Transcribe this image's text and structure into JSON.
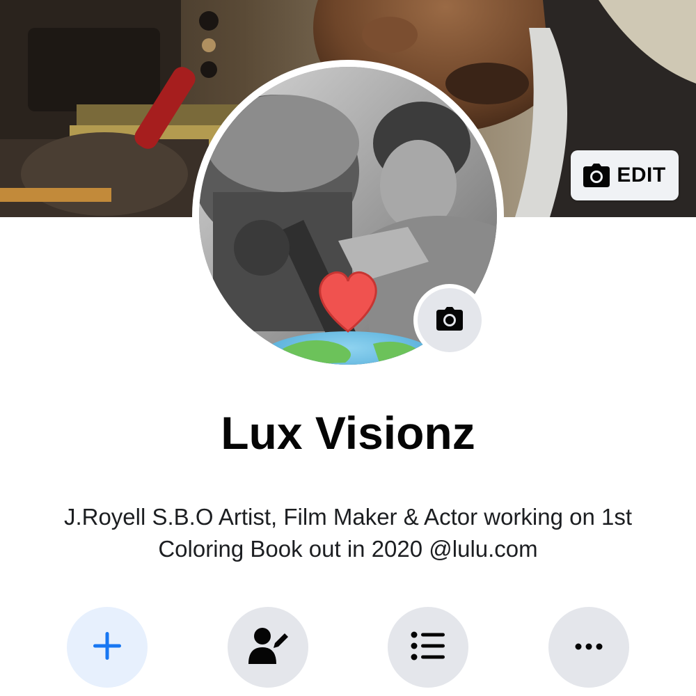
{
  "cover": {
    "edit_label": "EDIT",
    "edit_icon": "camera-icon"
  },
  "profile": {
    "name": "Lux Visionz",
    "bio": "J.Royell S.B.O Artist, Film Maker & Actor working on 1st Coloring Book out in 2020 @lulu.com",
    "camera_icon": "camera-icon"
  },
  "actions": [
    {
      "icon": "plus-icon"
    },
    {
      "icon": "edit-profile-icon"
    },
    {
      "icon": "activity-log-icon"
    },
    {
      "icon": "more-icon"
    }
  ],
  "colors": {
    "accent": "#1877f2",
    "button_bg": "#e4e6eb",
    "primary_button_bg": "#e7f0fd",
    "text": "#050505",
    "heart": "#f0524f"
  }
}
